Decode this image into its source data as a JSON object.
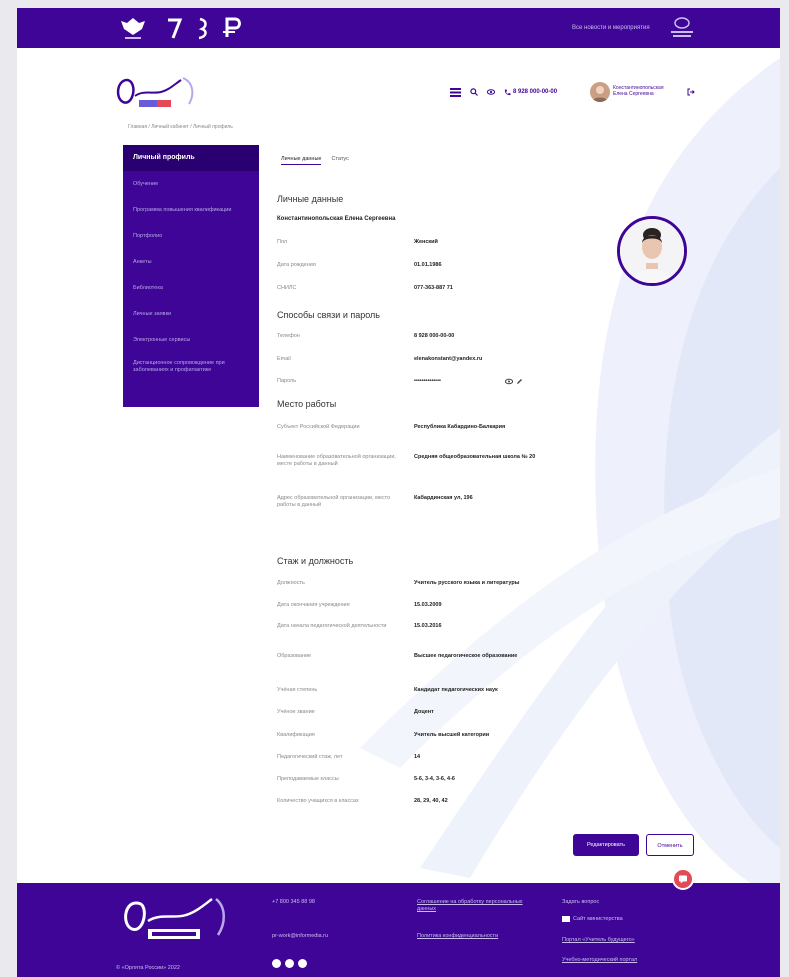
{
  "topbar": {
    "link": "Все новости и мероприятия"
  },
  "header": {
    "phone": "8 928 000-00-00",
    "user_line1": "Константинопольская",
    "user_line2": "Елена Сергеевна"
  },
  "breadcrumb": "Главная / Личный кабинет / Личный профиль",
  "sidebar": {
    "items": [
      {
        "label": "Личный профиль"
      },
      {
        "label": "Обучение"
      },
      {
        "label": "Программа повышения квалификации"
      },
      {
        "label": "Портфолио"
      },
      {
        "label": "Анкеты"
      },
      {
        "label": "Библиотека"
      },
      {
        "label": "Личные заявки"
      },
      {
        "label": "Электронные сервисы"
      },
      {
        "label": "Дистанционное сопровождение при заболеваниях и профилактике"
      }
    ]
  },
  "tabs": [
    "Личные данные",
    "Статус"
  ],
  "personal": {
    "title": "Личные данные",
    "fullname": "Константинопольская Елена Сергеевна",
    "rows": [
      {
        "label": "Пол",
        "value": "Женский"
      },
      {
        "label": "Дата рождения",
        "value": "01.01.1986"
      },
      {
        "label": "СНИЛС",
        "value": "077-363-887 71"
      }
    ]
  },
  "contacts": {
    "title": "Способы связи и пароль",
    "rows": [
      {
        "label": "Телефон",
        "value": "8 928 000-00-00"
      },
      {
        "label": "Email",
        "value": "elenakonstant@yandex.ru"
      },
      {
        "label": "Пароль",
        "value": "••••••••••••••"
      }
    ]
  },
  "work": {
    "title": "Место работы",
    "rows": [
      {
        "label": "Субъект Российской Федерации",
        "value": "Республика Кабардино-Балкария"
      },
      {
        "label": "Наименование образовательной организации, месте работы в данный",
        "value": "Средняя общеобразовательная школа № 20"
      },
      {
        "label": "Адрес образовательной организации, место работы в данный",
        "value": "Кабардинская ул, 196"
      }
    ]
  },
  "position": {
    "title": "Стаж и должность",
    "rows": [
      {
        "label": "Должность",
        "value": "Учитель русского языка и литературы"
      },
      {
        "label": "Дата окончания учреждения",
        "value": "15.03.2009"
      },
      {
        "label": "Дата начала педагогической деятельности",
        "value": "15.03.2016"
      },
      {
        "label": "Образование",
        "value": "Высшее педагогическое образование"
      },
      {
        "label": "Учёная степень",
        "value": "Кандидат педагогических наук"
      },
      {
        "label": "Учёное звание",
        "value": "Доцент"
      },
      {
        "label": "Квалификация",
        "value": "Учитель высшей категории"
      },
      {
        "label": "Педагогический стаж, лет",
        "value": "14"
      },
      {
        "label": "Преподаваемые классы",
        "value": "5-6, 3-4, 3-6, 4-6"
      },
      {
        "label": "Количество учащихся в классах",
        "value": "28, 29, 40, 42"
      }
    ]
  },
  "buttons": {
    "save": "Редактировать",
    "cancel": "Отменить"
  },
  "footer": {
    "phone": "+7 800 345 88 98",
    "email": "pr-work@informedia.ru",
    "links_col2": [
      "Соглашение на обработку персональных данных",
      "Политика конфиденциальности"
    ],
    "col3_title": "Задать вопрос",
    "col3_items": [
      "Сайт министерства",
      "Портал «Учитель будущего»",
      "Учебно-методический портал"
    ],
    "copyright": "© «Орлята России» 2022"
  },
  "colors": {
    "brand": "#3e0597",
    "accent": "#e34956"
  }
}
